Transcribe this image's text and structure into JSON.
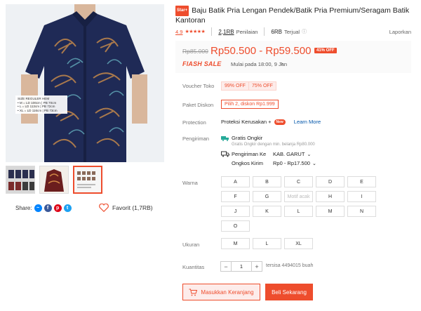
{
  "product": {
    "badge": "Star+",
    "title": "Baju Batik Pria Lengan Pendek/Batik Pria Premium/Seragam Batik Kantoran",
    "size_note": [
      "SIZE REGULER HEM",
      "• M = LD 106cm | PB 70cm",
      "• L = LD 113cm | PB 72cm",
      "• XL = LD 116cm | PB 73cm"
    ]
  },
  "rating": {
    "score": "4.9",
    "stars": "★★★★★",
    "reviews_count": "2,1RB",
    "reviews_label": "Penilaian",
    "sold_count": "6RB",
    "sold_label": "Terjual",
    "report": "Laporkan"
  },
  "price": {
    "original": "Rp85.000",
    "range": "Rp50.500 - Rp59.500",
    "discount": "41% OFF",
    "flash_label": "FlASH SALE",
    "flash_time": "Mulai pada 18:00, 9 Jan",
    "chevron": "›"
  },
  "voucher": {
    "label": "Voucher Toko",
    "items": [
      "99% OFF",
      "75% OFF"
    ]
  },
  "bundle": {
    "label": "Paket Diskon",
    "value": "Pilih 2, diskon Rp1.999"
  },
  "protection": {
    "label": "Protection",
    "value": "Proteksi Kerusakan +",
    "badge": "New",
    "link": "Learn More"
  },
  "shipping": {
    "label": "Pengiriman",
    "free": "Gratis Ongkir",
    "free_sub": "Gratis Ongkir dengan min. belanja Rp80.000",
    "to_label": "Pengiriman Ke",
    "to_value": "KAB. GARUT",
    "cost_label": "Ongkos Kirim",
    "cost_value": "Rp0 - Rp17.500"
  },
  "variants": {
    "color_label": "Warna",
    "colors": [
      "A",
      "B",
      "C",
      "D",
      "E",
      "F",
      "G",
      "Motif acak",
      "H",
      "I",
      "J",
      "K",
      "L",
      "M",
      "N",
      "O"
    ],
    "size_label": "Ukuran",
    "sizes": [
      "M",
      "L",
      "XL"
    ]
  },
  "quantity": {
    "label": "Kuantitas",
    "minus": "−",
    "value": "1",
    "plus": "+",
    "stock": "tersisa 4494015 buah"
  },
  "actions": {
    "cart": "Masukkan Keranjang",
    "buy": "Beli Sekarang"
  },
  "social": {
    "share_label": "Share:",
    "favorite": "Favorit (1,7RB)"
  },
  "colors": {
    "accent": "#ee4d2d",
    "shirt_navy": "#1f2a56",
    "batik_pattern": "#b8824c"
  }
}
